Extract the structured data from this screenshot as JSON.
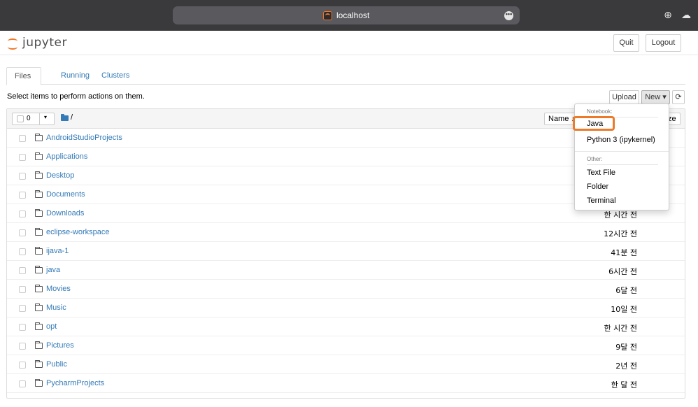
{
  "browser": {
    "url": "localhost",
    "more_glyph": "•••",
    "download_glyph": "⊕",
    "cloud_glyph": "☁"
  },
  "header": {
    "logo_text": "jupyter",
    "quit_label": "Quit",
    "logout_label": "Logout"
  },
  "tabs": [
    {
      "label": "Files"
    },
    {
      "label": "Running"
    },
    {
      "label": "Clusters"
    }
  ],
  "toolbar": {
    "hint": "Select items to perform actions on them.",
    "upload_label": "Upload",
    "new_label": "New ▾",
    "refresh_glyph": "⟳"
  },
  "list_header": {
    "selected_count": "0",
    "caret": "▾",
    "root": "/",
    "name_sort_label": "Name ↓",
    "size_sort_label": "ze"
  },
  "rows": [
    {
      "name": "AndroidStudioProjects",
      "time": ""
    },
    {
      "name": "Applications",
      "time": ""
    },
    {
      "name": "Desktop",
      "time": ""
    },
    {
      "name": "Documents",
      "time": ""
    },
    {
      "name": "Downloads",
      "time": "한 시간 전"
    },
    {
      "name": "eclipse-workspace",
      "time": "12시간 전"
    },
    {
      "name": "ijava-1",
      "time": "41분 전"
    },
    {
      "name": "java",
      "time": "6시간 전"
    },
    {
      "name": "Movies",
      "time": "6달 전"
    },
    {
      "name": "Music",
      "time": "10일 전"
    },
    {
      "name": "opt",
      "time": "한 시간 전"
    },
    {
      "name": "Pictures",
      "time": "9달 전"
    },
    {
      "name": "Public",
      "time": "2년 전"
    },
    {
      "name": "PycharmProjects",
      "time": "한 달 전"
    }
  ],
  "new_menu": {
    "notebook_header": "Notebook:",
    "java": "Java",
    "python": "Python 3 (ipykernel)",
    "other_header": "Other:",
    "text_file": "Text File",
    "folder": "Folder",
    "terminal": "Terminal"
  },
  "colors": {
    "accent": "#f37626",
    "link": "#337ab7",
    "highlight": "#ec7a29"
  }
}
